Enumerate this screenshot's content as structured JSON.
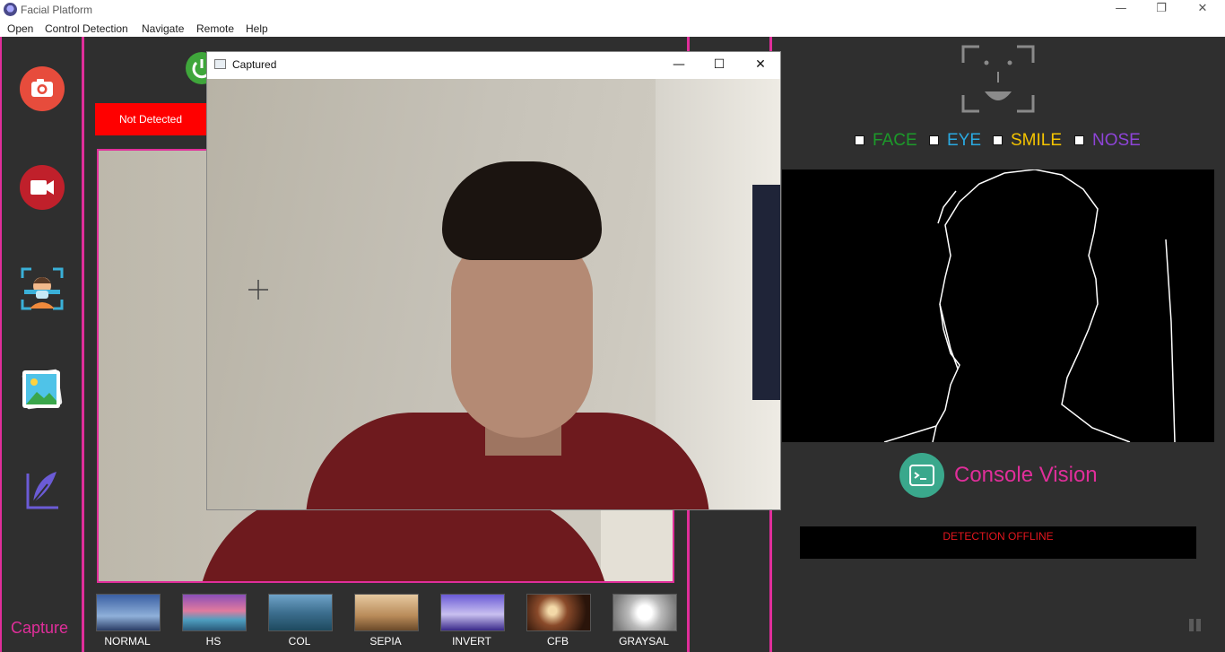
{
  "window": {
    "title": "Facial Platform",
    "controls": {
      "minimize": "—",
      "restore": "❐",
      "close": "✕"
    }
  },
  "menu": [
    "Open",
    "Control Detection",
    "Navigate",
    "Remote",
    "Help"
  ],
  "left_toolbar": {
    "buttons": [
      {
        "name": "camera-icon",
        "color": "#e74c3c"
      },
      {
        "name": "video-camera-icon",
        "color": "#c0202b"
      },
      {
        "name": "face-scan-icon"
      },
      {
        "name": "gallery-icon"
      },
      {
        "name": "feather-pen-icon"
      }
    ],
    "capture_label": "Capture"
  },
  "center": {
    "status": "Not Detected",
    "status_color": "#ff0000"
  },
  "filters": [
    "NORMAL",
    "HS",
    "COL",
    "SEPIA",
    "INVERT",
    "CFB",
    "GRAYSAL"
  ],
  "captured_window": {
    "title": "Captured",
    "controls": {
      "minimize": "—",
      "maximize": "☐",
      "close": "✕"
    }
  },
  "right_panel": {
    "checkboxes": [
      {
        "label": "FACE",
        "color": "#1c9a2a"
      },
      {
        "label": "EYE",
        "color": "#2aa9e0"
      },
      {
        "label": "SMILE",
        "color": "#f5c400"
      },
      {
        "label": "NOSE",
        "color": "#8e44d8"
      }
    ],
    "console_title": "Console Vision",
    "detection_status": "DETECTION OFFLINE"
  },
  "colors": {
    "accent_pink": "#e02e9a",
    "background": "#2f2f2f"
  }
}
